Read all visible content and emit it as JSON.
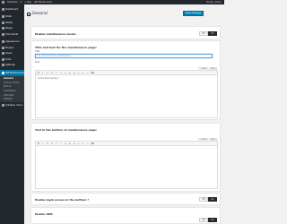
{
  "adminbar": {
    "items": [
      "SiteName",
      "0",
      "+ New",
      "WP Maintenance"
    ],
    "howdy": "Howdy, admin"
  },
  "sidebar": {
    "items": [
      {
        "label": "Dashboard",
        "icon": "gauge-icon"
      },
      {
        "label": "Posts",
        "icon": "pin-icon"
      },
      {
        "label": "Media",
        "icon": "media-icon"
      },
      {
        "label": "Pages",
        "icon": "page-icon"
      },
      {
        "label": "Comments",
        "icon": "comment-icon"
      },
      {
        "label": "Appearance",
        "icon": "brush-icon"
      },
      {
        "label": "Plugins",
        "icon": "plug-icon"
      },
      {
        "label": "Users",
        "icon": "user-icon"
      },
      {
        "label": "Tools",
        "icon": "wrench-icon"
      },
      {
        "label": "Settings",
        "icon": "settings-icon"
      },
      {
        "label": "WP Maintenance",
        "icon": "maintenance-icon"
      }
    ],
    "submenu": [
      "General",
      "Colors & Fonts",
      "Picture",
      "Countdown",
      "CSS Style",
      "Settings"
    ],
    "collapse": "Collapse menu"
  },
  "page": {
    "title": "General",
    "save_label": "Save Changes"
  },
  "toggle": {
    "off": "Off",
    "on": "On"
  },
  "sections": {
    "maintenance_mode": "Enable maintenance mode:",
    "title_text": "Title and text for the maintenance page:",
    "title_field_label": "Title",
    "title_value": "I'm not known for maintenance",
    "text_field_label": "Text",
    "editor_tabs": [
      "Visual",
      "Text"
    ],
    "editor_content": "Come back quickly!",
    "footer_text": "Text in the bottom of maintenance page:",
    "login_access": "Enable login access in the bottom ?",
    "seo": "Enable SEO:"
  },
  "toolbar_buttons": [
    "B",
    "I",
    "≡",
    "≡",
    "❝",
    "—",
    "≡",
    "≡",
    "≡",
    "∞",
    "✂",
    "—",
    "⌨"
  ]
}
